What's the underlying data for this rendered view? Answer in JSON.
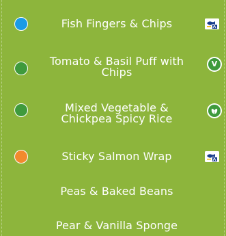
{
  "menu_items": [
    {
      "label": "Fish Fingers & Chips",
      "dot_color": "#1a9be6",
      "badge": "msc-fish-icon"
    },
    {
      "label": "Tomato & Basil Puff with Chips",
      "dot_color": "#3f9a3c",
      "badge": "vegetarian-v-icon",
      "badge_text": "V"
    },
    {
      "label": "Mixed Vegetable & Chickpea Spicy Rice",
      "dot_color": "#3f9a3c",
      "badge": "vegan-leaf-icon"
    },
    {
      "label": "Sticky Salmon Wrap",
      "dot_color": "#f28a2e",
      "badge": "msc-fish-icon"
    },
    {
      "label": "Peas & Baked Beans"
    },
    {
      "label": "Pear & Vanilla Sponge"
    }
  ],
  "colors": {
    "background": "#8db53c",
    "text": "#ffffff",
    "vegetarian_green": "#3f9a3c",
    "msc_blue": "#1b3f8c"
  }
}
